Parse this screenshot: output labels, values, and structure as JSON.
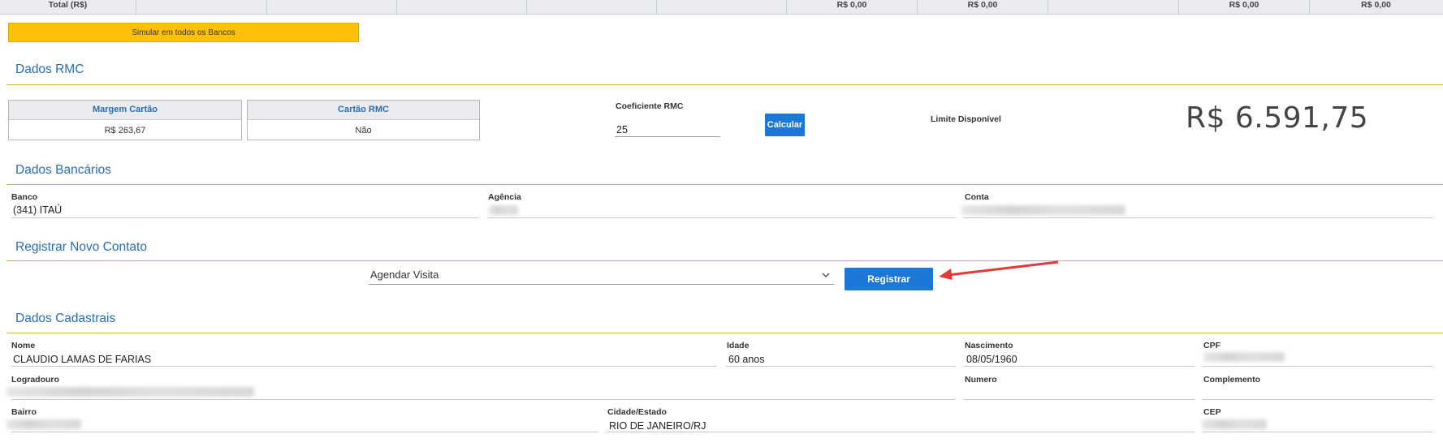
{
  "totals": {
    "label": "Total (R$)",
    "values": [
      "R$ 0,00",
      "R$ 0,00",
      "R$ 0,00",
      "R$ 0,00"
    ]
  },
  "simulate_button": "Simular em todos os Bancos",
  "sections": {
    "rmc": "Dados RMC",
    "bank": "Dados Bancários",
    "contact": "Registrar Novo Contato",
    "registration": "Dados Cadastrais"
  },
  "rmc": {
    "margem_label": "Margem Cartão",
    "margem_value": "R$ 263,67",
    "cartao_label": "Cartão RMC",
    "cartao_value": "Não",
    "coef_label": "Coeficiente RMC",
    "coef_value": "25",
    "calc_button": "Calcular",
    "limit_label": "Limite Disponível",
    "limit_value": "R$ 6.591,75"
  },
  "bank": {
    "banco_label": "Banco",
    "banco_value": "(341) ITAÚ",
    "agencia_label": "Agência",
    "conta_label": "Conta"
  },
  "contact": {
    "selected_option": "Agendar Visita",
    "register_button": "Registrar"
  },
  "cadastro": {
    "nome_label": "Nome",
    "nome_value": "CLAUDIO LAMAS DE FARIAS",
    "idade_label": "Idade",
    "idade_value": "60 anos",
    "nascimento_label": "Nascimento",
    "nascimento_value": "08/05/1960",
    "cpf_label": "CPF",
    "logradouro_label": "Logradouro",
    "numero_label": "Numero",
    "complemento_label": "Complemento",
    "bairro_label": "Bairro",
    "cidade_label": "Cidade/Estado",
    "cidade_value": "RIO DE JANEIRO/RJ",
    "cep_label": "CEP"
  },
  "colors": {
    "accent_blue": "#1c77d6",
    "section_title": "#2a6db5",
    "divider": "#d9b13a",
    "yellow_button": "#ffc107",
    "annotation_arrow": "#e53935"
  }
}
